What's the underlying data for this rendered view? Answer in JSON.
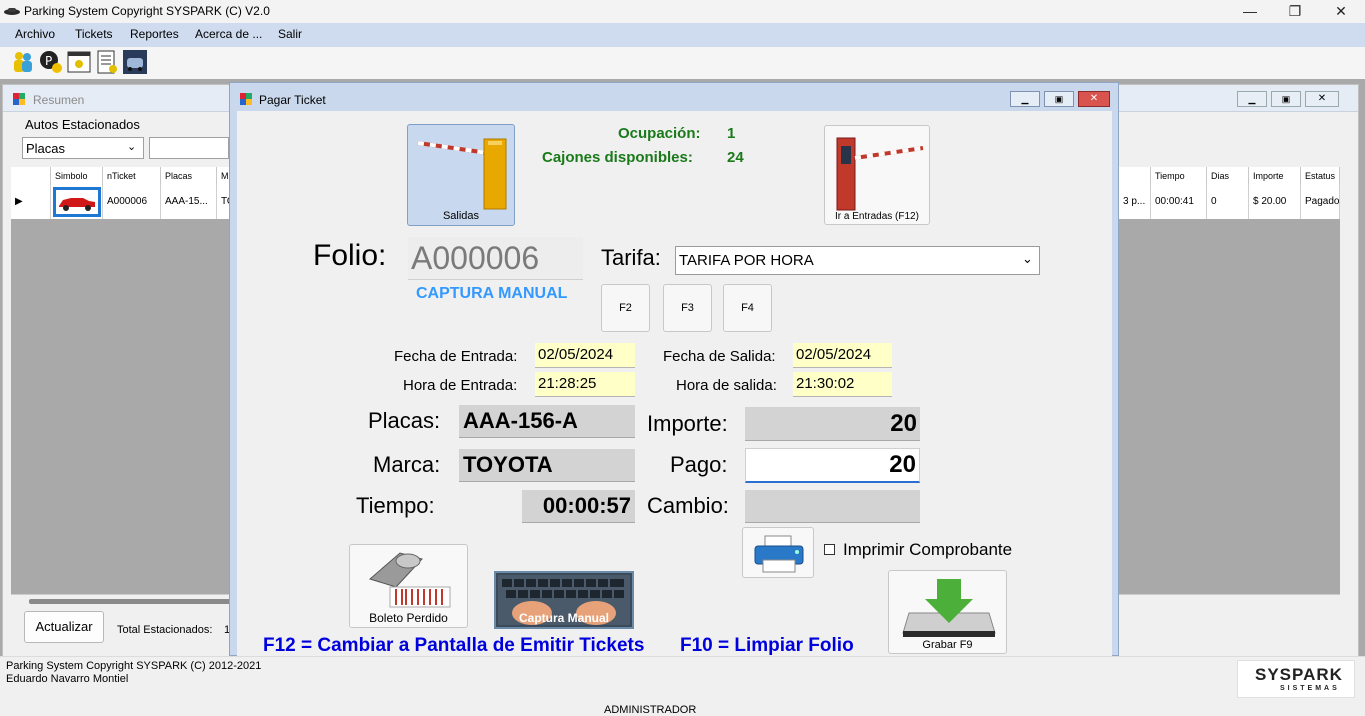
{
  "window": {
    "title": "Parking System Copyright SYSPARK (C) V2.0",
    "minimize": "—",
    "maximize": "❐",
    "close": "✕"
  },
  "menu": [
    "Archivo",
    "Tickets",
    "Reportes",
    "Acerca de ...",
    "Salir"
  ],
  "resumen": {
    "title": "Resumen",
    "autos_label": "Autos Estacionados",
    "filter_value": "Placas",
    "headers": [
      "Simbolo",
      "nTicket",
      "Placas",
      "M",
      "Tiempo",
      "Dias",
      "Importe",
      "Estatus"
    ],
    "row": {
      "nticket": "A000006",
      "placas": "AAA-15...",
      "m": "TO",
      "hidden": "3 p...",
      "tiempo": "00:00:41",
      "dias": "0",
      "importe": "$ 20.00",
      "estatus": "Pagado"
    },
    "actualizar": "Actualizar",
    "total_label": "Total Estacionados:",
    "total_value": "1"
  },
  "dialog": {
    "title": "Pagar Ticket",
    "salidas": "Salidas",
    "ocupacion_label": "Ocupación:",
    "ocupacion_value": "1",
    "cajones_label": "Cajones disponibles:",
    "cajones_value": "24",
    "ir_entradas": "Ir a Entradas (F12)",
    "folio_label": "Folio:",
    "folio_value": "A000006",
    "captura_manual_link": "CAPTURA MANUAL",
    "tarifa_label": "Tarifa:",
    "tarifa_value": "TARIFA POR HORA",
    "f2": "F2",
    "f3": "F3",
    "f4": "F4",
    "fecha_entrada_label": "Fecha de Entrada:",
    "fecha_entrada": "02/05/2024",
    "hora_entrada_label": "Hora de Entrada:",
    "hora_entrada": "21:28:25",
    "fecha_salida_label": "Fecha de Salida:",
    "fecha_salida": "02/05/2024",
    "hora_salida_label": "Hora de salida:",
    "hora_salida": "21:30:02",
    "placas_label": "Placas:",
    "placas_value": "AAA-156-A",
    "marca_label": "Marca:",
    "marca_value": "TOYOTA",
    "tiempo_label": "Tiempo:",
    "tiempo_value": "00:00:57",
    "importe_label": "Importe:",
    "importe_value": "20",
    "pago_label": "Pago:",
    "pago_value": "20",
    "cambio_label": "Cambio:",
    "cambio_value": "",
    "imprimir_label": "Imprimir Comprobante",
    "boleto_perdido": "Boleto Perdido",
    "captura_manual_btn": "Captura Manual",
    "grabar": "Grabar  F9",
    "hint1": "F12 = Cambiar a Pantalla de Emitir Tickets",
    "hint2": "F10 = Limpiar Folio"
  },
  "status": {
    "line1": "Parking System Copyright SYSPARK (C) 2012-2021",
    "line2": "Eduardo Navarro Montiel",
    "user": "ADMINISTRADOR",
    "logo_text": "SYSPARK",
    "logo_sub": "SISTEMAS"
  },
  "colors": {
    "menubar": "#cfdcef",
    "ocupacion_green": "#1a7a1a",
    "link_blue": "#3399ff",
    "hint_blue": "#0000dd",
    "yellow_field": "#ffffc8"
  }
}
